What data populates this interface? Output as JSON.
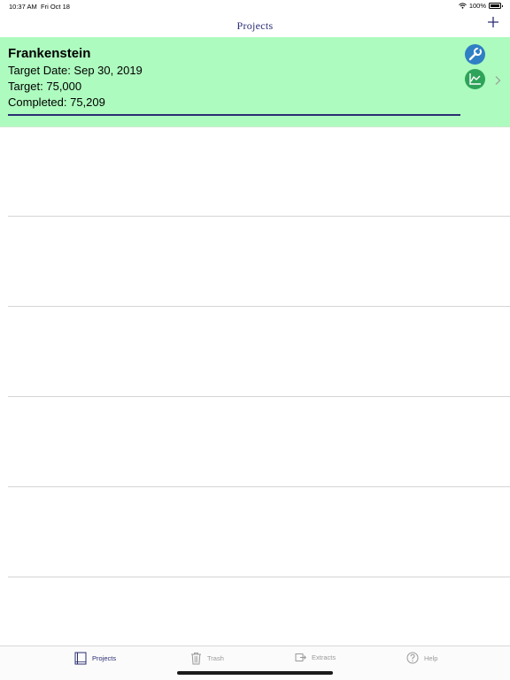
{
  "status_bar": {
    "time": "10:37 AM",
    "date": "Fri Oct 18",
    "battery": "100%"
  },
  "nav": {
    "title": "Projects",
    "add_icon": "plus-icon"
  },
  "project": {
    "name": "Frankenstein",
    "target_date": "Target Date: Sep 30, 2019",
    "target": "Target: 75,000",
    "completed": "Completed: 75,209",
    "background_color": "#adfbbe",
    "progress_fraction": 1.0,
    "edit_icon": "wrench-icon",
    "chart_icon": "line-chart-icon"
  },
  "tab_bar": {
    "tabs": [
      {
        "label": "Projects",
        "icon": "book-icon",
        "active": true
      },
      {
        "label": "Trash",
        "icon": "trash-icon",
        "active": false
      },
      {
        "label": "Extracts",
        "icon": "export-icon",
        "active": false
      },
      {
        "label": "Help",
        "icon": "question-icon",
        "active": false
      }
    ]
  },
  "colors": {
    "accent": "#2b2d73",
    "edit_button": "#2f7fc4",
    "chart_button": "#2ea35a"
  }
}
